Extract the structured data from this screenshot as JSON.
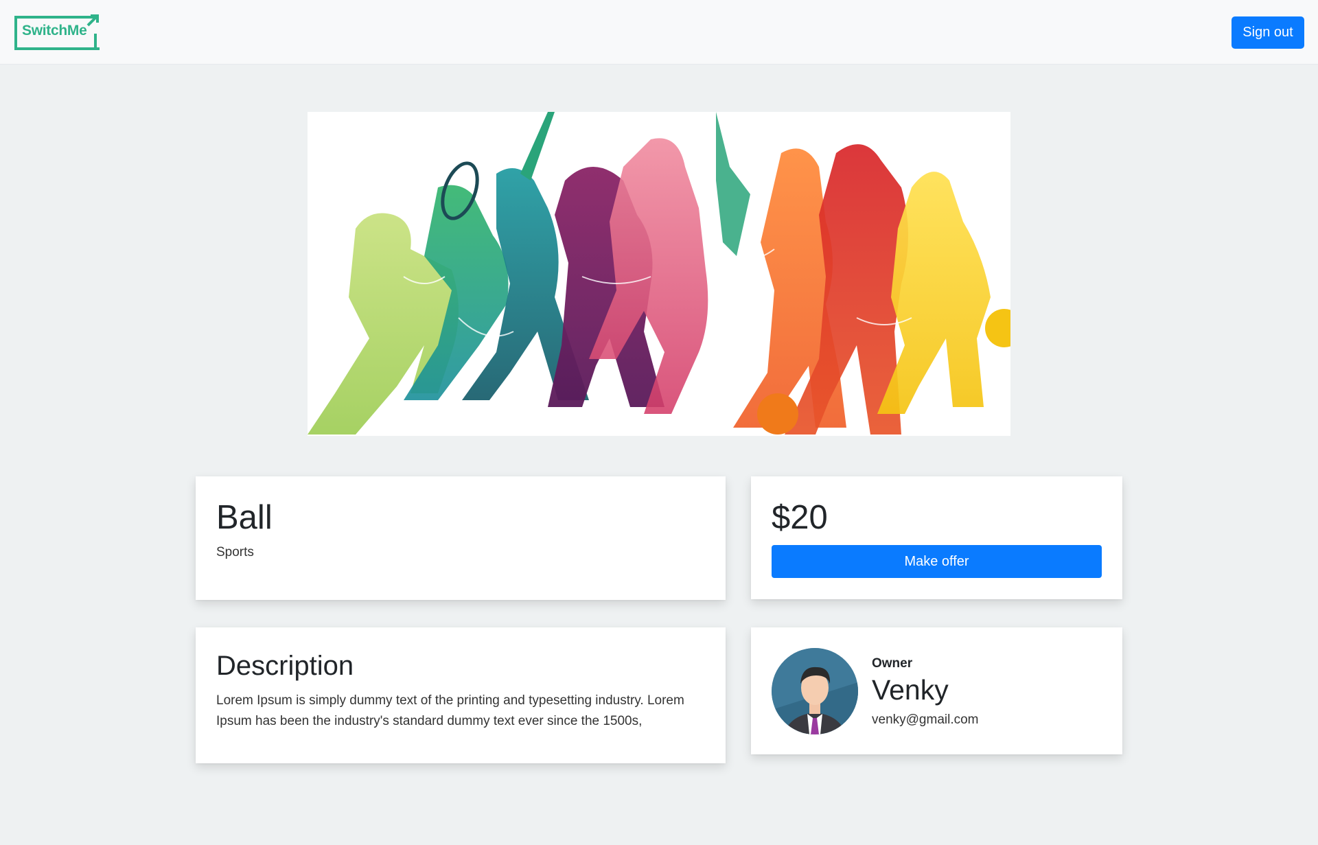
{
  "header": {
    "logo_text": "SwitchMe",
    "signout_label": "Sign out"
  },
  "product": {
    "title": "Ball",
    "category": "Sports",
    "price": "$20",
    "offer_label": "Make offer",
    "description_heading": "Description",
    "description": "Lorem Ipsum is simply dummy text of the printing and typesetting industry. Lorem Ipsum has been the industry's standard dummy text ever since the 1500s,"
  },
  "owner": {
    "label": "Owner",
    "name": "Venky",
    "email": "venky@gmail.com"
  },
  "colors": {
    "primary": "#0a7bff",
    "brand": "#2fb38a",
    "background": "#eef1f2"
  }
}
